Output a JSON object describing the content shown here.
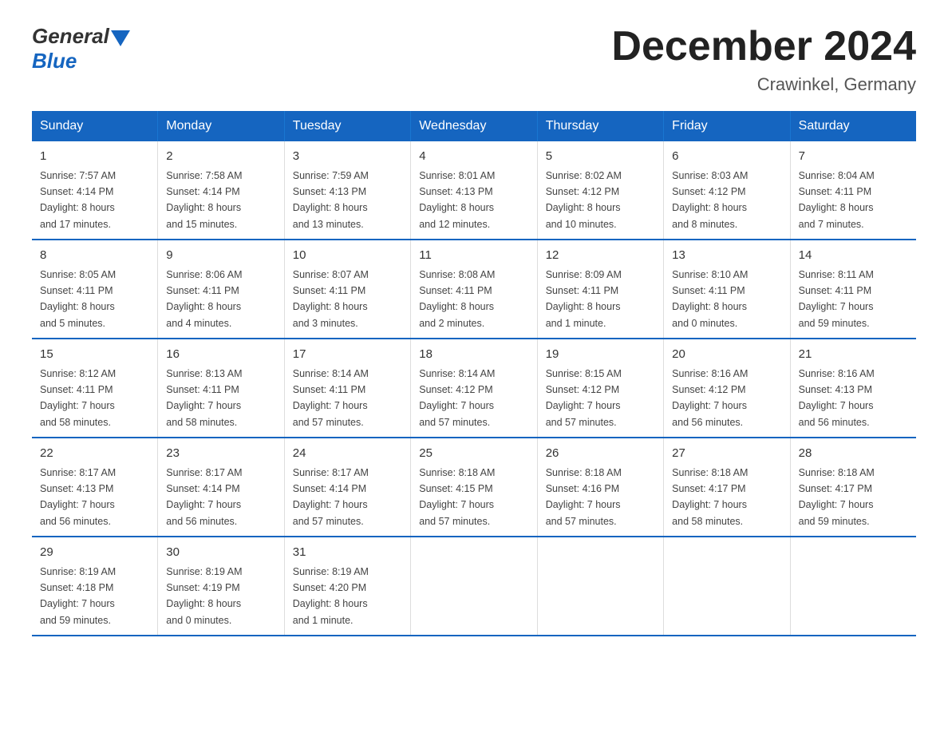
{
  "header": {
    "title": "December 2024",
    "subtitle": "Crawinkel, Germany"
  },
  "logo": {
    "general": "General",
    "blue": "Blue"
  },
  "days_of_week": [
    "Sunday",
    "Monday",
    "Tuesday",
    "Wednesday",
    "Thursday",
    "Friday",
    "Saturday"
  ],
  "weeks": [
    [
      {
        "day": "1",
        "info": "Sunrise: 7:57 AM\nSunset: 4:14 PM\nDaylight: 8 hours\nand 17 minutes."
      },
      {
        "day": "2",
        "info": "Sunrise: 7:58 AM\nSunset: 4:14 PM\nDaylight: 8 hours\nand 15 minutes."
      },
      {
        "day": "3",
        "info": "Sunrise: 7:59 AM\nSunset: 4:13 PM\nDaylight: 8 hours\nand 13 minutes."
      },
      {
        "day": "4",
        "info": "Sunrise: 8:01 AM\nSunset: 4:13 PM\nDaylight: 8 hours\nand 12 minutes."
      },
      {
        "day": "5",
        "info": "Sunrise: 8:02 AM\nSunset: 4:12 PM\nDaylight: 8 hours\nand 10 minutes."
      },
      {
        "day": "6",
        "info": "Sunrise: 8:03 AM\nSunset: 4:12 PM\nDaylight: 8 hours\nand 8 minutes."
      },
      {
        "day": "7",
        "info": "Sunrise: 8:04 AM\nSunset: 4:11 PM\nDaylight: 8 hours\nand 7 minutes."
      }
    ],
    [
      {
        "day": "8",
        "info": "Sunrise: 8:05 AM\nSunset: 4:11 PM\nDaylight: 8 hours\nand 5 minutes."
      },
      {
        "day": "9",
        "info": "Sunrise: 8:06 AM\nSunset: 4:11 PM\nDaylight: 8 hours\nand 4 minutes."
      },
      {
        "day": "10",
        "info": "Sunrise: 8:07 AM\nSunset: 4:11 PM\nDaylight: 8 hours\nand 3 minutes."
      },
      {
        "day": "11",
        "info": "Sunrise: 8:08 AM\nSunset: 4:11 PM\nDaylight: 8 hours\nand 2 minutes."
      },
      {
        "day": "12",
        "info": "Sunrise: 8:09 AM\nSunset: 4:11 PM\nDaylight: 8 hours\nand 1 minute."
      },
      {
        "day": "13",
        "info": "Sunrise: 8:10 AM\nSunset: 4:11 PM\nDaylight: 8 hours\nand 0 minutes."
      },
      {
        "day": "14",
        "info": "Sunrise: 8:11 AM\nSunset: 4:11 PM\nDaylight: 7 hours\nand 59 minutes."
      }
    ],
    [
      {
        "day": "15",
        "info": "Sunrise: 8:12 AM\nSunset: 4:11 PM\nDaylight: 7 hours\nand 58 minutes."
      },
      {
        "day": "16",
        "info": "Sunrise: 8:13 AM\nSunset: 4:11 PM\nDaylight: 7 hours\nand 58 minutes."
      },
      {
        "day": "17",
        "info": "Sunrise: 8:14 AM\nSunset: 4:11 PM\nDaylight: 7 hours\nand 57 minutes."
      },
      {
        "day": "18",
        "info": "Sunrise: 8:14 AM\nSunset: 4:12 PM\nDaylight: 7 hours\nand 57 minutes."
      },
      {
        "day": "19",
        "info": "Sunrise: 8:15 AM\nSunset: 4:12 PM\nDaylight: 7 hours\nand 57 minutes."
      },
      {
        "day": "20",
        "info": "Sunrise: 8:16 AM\nSunset: 4:12 PM\nDaylight: 7 hours\nand 56 minutes."
      },
      {
        "day": "21",
        "info": "Sunrise: 8:16 AM\nSunset: 4:13 PM\nDaylight: 7 hours\nand 56 minutes."
      }
    ],
    [
      {
        "day": "22",
        "info": "Sunrise: 8:17 AM\nSunset: 4:13 PM\nDaylight: 7 hours\nand 56 minutes."
      },
      {
        "day": "23",
        "info": "Sunrise: 8:17 AM\nSunset: 4:14 PM\nDaylight: 7 hours\nand 56 minutes."
      },
      {
        "day": "24",
        "info": "Sunrise: 8:17 AM\nSunset: 4:14 PM\nDaylight: 7 hours\nand 57 minutes."
      },
      {
        "day": "25",
        "info": "Sunrise: 8:18 AM\nSunset: 4:15 PM\nDaylight: 7 hours\nand 57 minutes."
      },
      {
        "day": "26",
        "info": "Sunrise: 8:18 AM\nSunset: 4:16 PM\nDaylight: 7 hours\nand 57 minutes."
      },
      {
        "day": "27",
        "info": "Sunrise: 8:18 AM\nSunset: 4:17 PM\nDaylight: 7 hours\nand 58 minutes."
      },
      {
        "day": "28",
        "info": "Sunrise: 8:18 AM\nSunset: 4:17 PM\nDaylight: 7 hours\nand 59 minutes."
      }
    ],
    [
      {
        "day": "29",
        "info": "Sunrise: 8:19 AM\nSunset: 4:18 PM\nDaylight: 7 hours\nand 59 minutes."
      },
      {
        "day": "30",
        "info": "Sunrise: 8:19 AM\nSunset: 4:19 PM\nDaylight: 8 hours\nand 0 minutes."
      },
      {
        "day": "31",
        "info": "Sunrise: 8:19 AM\nSunset: 4:20 PM\nDaylight: 8 hours\nand 1 minute."
      },
      {
        "day": "",
        "info": ""
      },
      {
        "day": "",
        "info": ""
      },
      {
        "day": "",
        "info": ""
      },
      {
        "day": "",
        "info": ""
      }
    ]
  ]
}
